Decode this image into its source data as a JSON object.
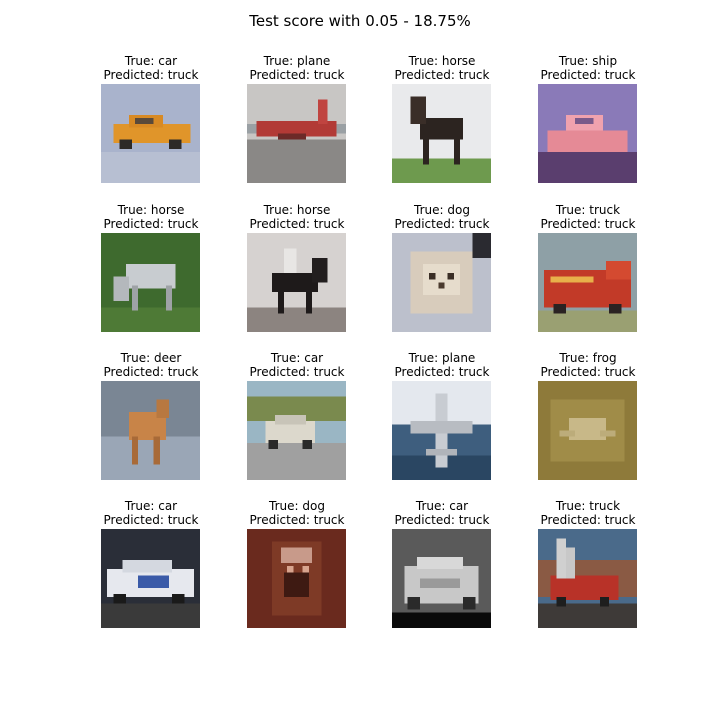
{
  "figure": {
    "title": "Test score with 0.05 - 18.75%"
  },
  "samples": [
    {
      "true_label": "True: car",
      "predicted_label": "Predicted: truck",
      "content": "orange sports car on blue background"
    },
    {
      "true_label": "True: plane",
      "predicted_label": "Predicted: truck",
      "content": "red plane on tarmac"
    },
    {
      "true_label": "True: horse",
      "predicted_label": "Predicted: truck",
      "content": "dark horse standing on grass"
    },
    {
      "true_label": "True: ship",
      "predicted_label": "Predicted: truck",
      "content": "pink boat on purple water"
    },
    {
      "true_label": "True: horse",
      "predicted_label": "Predicted: truck",
      "content": "grey horse grazing on green field"
    },
    {
      "true_label": "True: horse",
      "predicted_label": "Predicted: truck",
      "content": "rider on black horse"
    },
    {
      "true_label": "True: dog",
      "predicted_label": "Predicted: truck",
      "content": "fluffy small dog close-up"
    },
    {
      "true_label": "True: truck",
      "predicted_label": "Predicted: truck",
      "content": "red fire truck"
    },
    {
      "true_label": "True: deer",
      "predicted_label": "Predicted: truck",
      "content": "brown deer on rocky ground"
    },
    {
      "true_label": "True: car",
      "predicted_label": "Predicted: truck",
      "content": "white SUV on road"
    },
    {
      "true_label": "True: plane",
      "predicted_label": "Predicted: truck",
      "content": "grey jet against blue sky"
    },
    {
      "true_label": "True: frog",
      "predicted_label": "Predicted: truck",
      "content": "camouflaged frog on sand"
    },
    {
      "true_label": "True: car",
      "predicted_label": "Predicted: truck",
      "content": "police car"
    },
    {
      "true_label": "True: dog",
      "predicted_label": "Predicted: truck",
      "content": "brown dog face close-up"
    },
    {
      "true_label": "True: car",
      "predicted_label": "Predicted: truck",
      "content": "silver car front view"
    },
    {
      "true_label": "True: truck",
      "predicted_label": "Predicted: truck",
      "content": "fire truck with ladder"
    }
  ]
}
